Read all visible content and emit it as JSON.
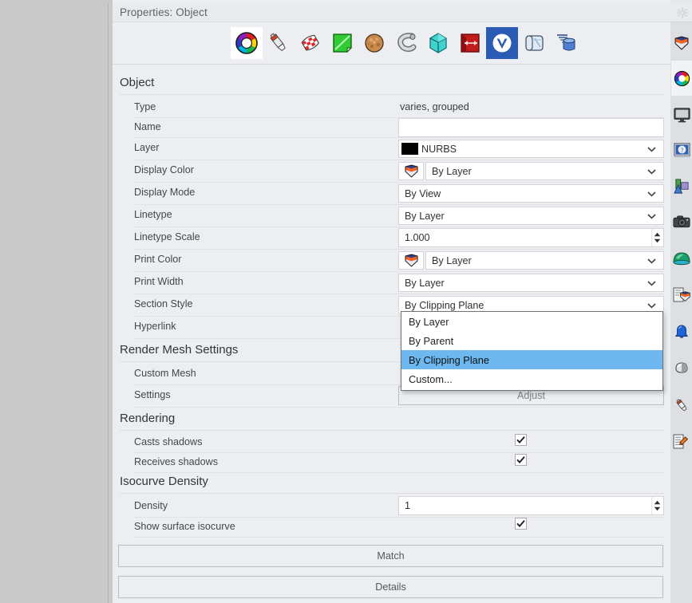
{
  "panel": {
    "title": "Properties: Object",
    "gear_icon": "gear-icon"
  },
  "toolbar": {
    "icons": [
      {
        "name": "object-properties-color-wheel-icon",
        "label": "Object",
        "selected": true
      },
      {
        "name": "material-tube-icon",
        "label": "Material",
        "selected": false
      },
      {
        "name": "texture-mapping-icon",
        "label": "Texture Mapping",
        "selected": false
      },
      {
        "name": "display-page-icon",
        "label": "Display",
        "selected": false
      },
      {
        "name": "bump-sphere-icon",
        "label": "Bump",
        "selected": false
      },
      {
        "name": "curve-piping-icon",
        "label": "Curve Piping",
        "selected": false
      },
      {
        "name": "shut-lining-icon",
        "label": "Shut Lining",
        "selected": false
      },
      {
        "name": "displacement-icon",
        "label": "Displacement",
        "selected": false
      },
      {
        "name": "vray-logo-icon",
        "label": "V-Ray",
        "selected_blue": true
      },
      {
        "name": "edge-softening-icon",
        "label": "Edge Softening",
        "selected": false
      },
      {
        "name": "thickness-icon",
        "label": "Thickness",
        "selected": false
      }
    ]
  },
  "groups": {
    "object": "Object",
    "render_mesh": "Render Mesh Settings",
    "rendering": "Rendering",
    "isocurve": "Isocurve Density"
  },
  "rows": {
    "type": {
      "label": "Type",
      "value": "varies, grouped"
    },
    "name": {
      "label": "Name",
      "value": ""
    },
    "layer": {
      "label": "Layer",
      "value": "NURBS",
      "swatch": "#000000"
    },
    "display_color": {
      "label": "Display Color",
      "value": "By Layer",
      "icon": "color-shield-icon"
    },
    "display_mode": {
      "label": "Display Mode",
      "value": "By View"
    },
    "linetype": {
      "label": "Linetype",
      "value": "By Layer"
    },
    "linetype_scale": {
      "label": "Linetype Scale",
      "value": "1.000"
    },
    "print_color": {
      "label": "Print Color",
      "value": "By Layer",
      "icon": "color-shield-icon"
    },
    "print_width": {
      "label": "Print Width",
      "value": "By Layer"
    },
    "section_style": {
      "label": "Section Style",
      "value": "By Clipping Plane"
    },
    "hyperlink": {
      "label": "Hyperlink",
      "value": ""
    },
    "custom_mesh": {
      "label": "Custom Mesh",
      "value": ""
    },
    "settings": {
      "label": "Settings",
      "value": "Adjust"
    },
    "casts_shadows": {
      "label": "Casts shadows",
      "checked": true
    },
    "receives_shadows": {
      "label": "Receives shadows",
      "checked": true
    },
    "density": {
      "label": "Density",
      "value": "1"
    },
    "show_surface_isocurve": {
      "label": "Show surface isocurve",
      "checked": true
    }
  },
  "dropdown": {
    "open": true,
    "highlight_color": "#6cb8ef",
    "items": [
      {
        "label": "By Layer",
        "highlighted": false
      },
      {
        "label": "By Parent",
        "highlighted": false
      },
      {
        "label": "By Clipping Plane",
        "highlighted": true
      },
      {
        "label": "Custom...",
        "highlighted": false
      }
    ]
  },
  "buttons": {
    "match": "Match",
    "details": "Details"
  },
  "rail": {
    "gear_icon": "gear-icon",
    "items": [
      {
        "name": "layers-shield-icon",
        "active": false
      },
      {
        "name": "color-wheel-properties-icon",
        "active": true
      },
      {
        "name": "display-monitor-icon",
        "active": false
      },
      {
        "name": "help-question-icon",
        "active": false
      },
      {
        "name": "named-views-icon",
        "active": false
      },
      {
        "name": "camera-icon",
        "active": false
      },
      {
        "name": "environment-dome-icon",
        "active": false
      },
      {
        "name": "layer-state-icon",
        "active": false
      },
      {
        "name": "notification-bell-icon",
        "active": false
      },
      {
        "name": "render-preview-icon",
        "active": false
      },
      {
        "name": "materials-tube-icon",
        "active": false
      },
      {
        "name": "annotation-edit-icon",
        "active": false
      }
    ]
  }
}
